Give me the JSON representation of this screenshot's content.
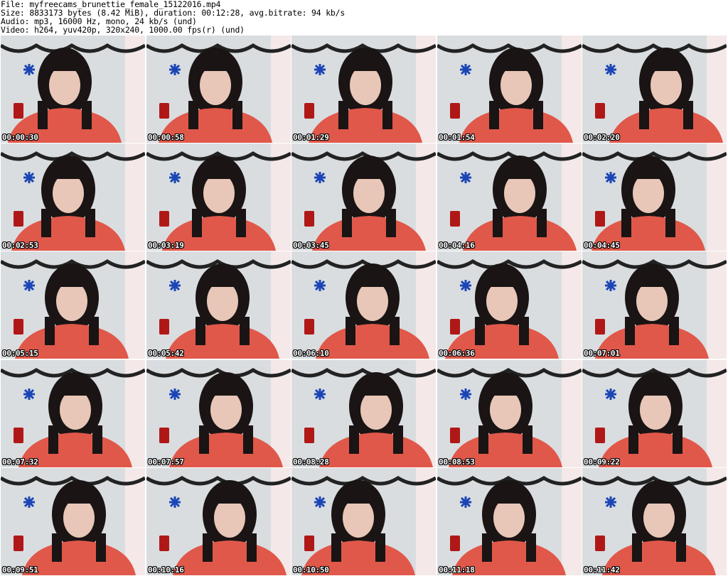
{
  "header": {
    "file_line": "File: myfreecams_brunettie_female_15122016.mp4",
    "size_line": "Size: 8833173 bytes (8.42 MiB), duration: 00:12:28, avg.bitrate: 94 kb/s",
    "audio_line": "Audio: mp3, 16000 Hz, mono, 24 kb/s (und)",
    "video_line": "Video: h264, yuv420p, 320x240, 1000.00 fps(r) (und)"
  },
  "thumbnails": [
    {
      "timestamp": "00:00:30"
    },
    {
      "timestamp": "00:00:58"
    },
    {
      "timestamp": "00:01:29"
    },
    {
      "timestamp": "00:01:54"
    },
    {
      "timestamp": "00:02:20"
    },
    {
      "timestamp": "00:02:53"
    },
    {
      "timestamp": "00:03:19"
    },
    {
      "timestamp": "00:03:45"
    },
    {
      "timestamp": "00:04:16"
    },
    {
      "timestamp": "00:04:45"
    },
    {
      "timestamp": "00:05:15"
    },
    {
      "timestamp": "00:05:42"
    },
    {
      "timestamp": "00:06:10"
    },
    {
      "timestamp": "00:06:36"
    },
    {
      "timestamp": "00:07:01"
    },
    {
      "timestamp": "00:07:32"
    },
    {
      "timestamp": "00:07:57"
    },
    {
      "timestamp": "00:08:28"
    },
    {
      "timestamp": "00:08:53"
    },
    {
      "timestamp": "00:09:22"
    },
    {
      "timestamp": "00:09:51"
    },
    {
      "timestamp": "00:10:16"
    },
    {
      "timestamp": "00:10:50"
    },
    {
      "timestamp": "00:11:18"
    },
    {
      "timestamp": "00:11:42"
    }
  ],
  "colors": {
    "background": "#ffffff",
    "wall": "#d9dde0",
    "shirt": "#e0584a",
    "hair": "#1a1414",
    "skin": "#e8c7b8",
    "garland": "#222222",
    "snowflake": "#1b45b5"
  }
}
